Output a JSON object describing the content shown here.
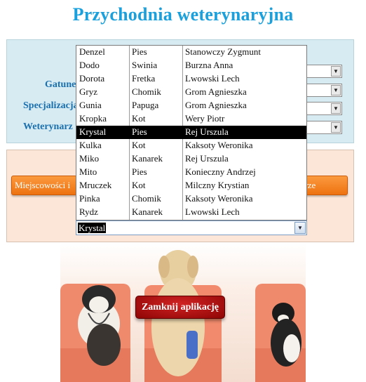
{
  "app": {
    "title": "Przychodnia weterynaryjna"
  },
  "filters": {
    "gatunek_label": "Gatunek",
    "specjalizacja_label": "Specjalizacja",
    "weterynarz_label": "Weterynarz"
  },
  "buttons": {
    "miejscowosci_label": "Miejscowości i",
    "right_label": "iarze",
    "close_label": "Zamknij aplikację"
  },
  "dropdown": {
    "selected_value": "Krystal",
    "rows": [
      {
        "name": "Denzel",
        "species": "Pies",
        "vet": "Stanowczy Zygmunt"
      },
      {
        "name": "Dodo",
        "species": "Swinia",
        "vet": "Burzna Anna"
      },
      {
        "name": "Dorota",
        "species": "Fretka",
        "vet": "Lwowski Lech"
      },
      {
        "name": "Gryz",
        "species": "Chomik",
        "vet": "Grom Agnieszka"
      },
      {
        "name": "Gunia",
        "species": "Papuga",
        "vet": "Grom Agnieszka"
      },
      {
        "name": "Kropka",
        "species": "Kot",
        "vet": "Wery Piotr"
      },
      {
        "name": "Krystal",
        "species": "Pies",
        "vet": "Rej Urszula",
        "selected": true
      },
      {
        "name": "Kulka",
        "species": "Kot",
        "vet": "Kaksoty Weronika"
      },
      {
        "name": "Miko",
        "species": "Kanarek",
        "vet": "Rej Urszula"
      },
      {
        "name": "Mito",
        "species": "Pies",
        "vet": "Konieczny Andrzej"
      },
      {
        "name": "Mruczek",
        "species": "Kot",
        "vet": "Milczny Krystian"
      },
      {
        "name": "Pinka",
        "species": "Chomik",
        "vet": "Kaksoty Weronika"
      },
      {
        "name": "Rydz",
        "species": "Kanarek",
        "vet": "Lwowski Lech"
      }
    ]
  },
  "colors": {
    "title": "#1aa0dc",
    "label": "#1a6fae",
    "panel_blue": "#d6ebf2",
    "panel_peach": "#fce6d8",
    "orange_button": "#f58220",
    "close_button": "#b01010",
    "selection": "#000000"
  }
}
